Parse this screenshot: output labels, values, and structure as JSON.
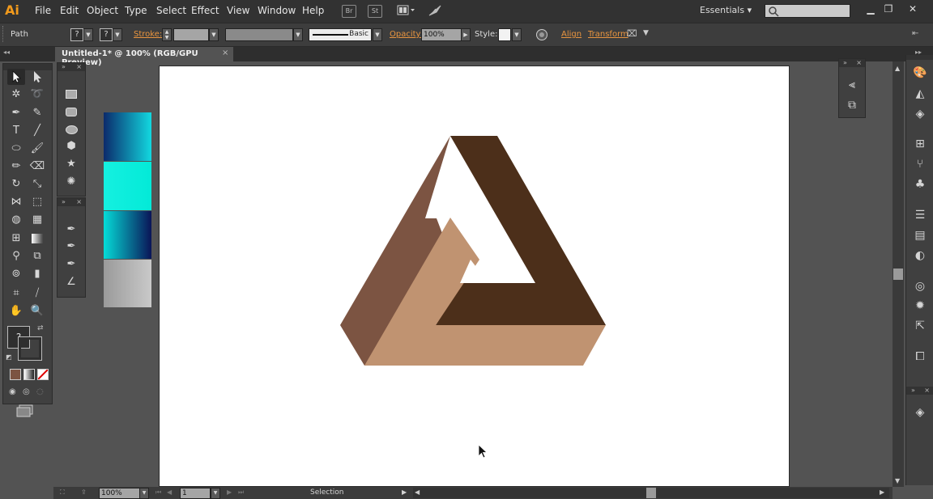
{
  "app": {
    "logo": "Ai"
  },
  "menu": [
    "File",
    "Edit",
    "Object",
    "Type",
    "Select",
    "Effect",
    "View",
    "Window",
    "Help"
  ],
  "menubar_icons": {
    "bridge": "Br",
    "stock": "St"
  },
  "workspace": "Essentials",
  "search": {
    "placeholder": ""
  },
  "control": {
    "selection_type": "Path",
    "fill_label": "?",
    "stroke_swatch_label": "?",
    "stroke_label": "Stroke:",
    "brush": "Basic",
    "opacity_label": "Opacity:",
    "opacity_value": "100%",
    "style_label": "Style:",
    "align_label": "Align",
    "transform_label": "Transform"
  },
  "document": {
    "tab_title": "Untitled-1* @ 100% (RGB/GPU Preview)"
  },
  "toolbox": {
    "fill_stroke_label": "?"
  },
  "gradient_swatches": [
    {
      "name": "navy-cyan",
      "from": "#0b2a6b",
      "to": "#12d8e0"
    },
    {
      "name": "cyan",
      "from": "#15f0e0",
      "to": "#03ead8"
    },
    {
      "name": "cyan-navy",
      "from": "#05dcd8",
      "to": "#0a1457"
    },
    {
      "name": "gray",
      "from": "#9a9a9a",
      "to": "#c9c9c9"
    }
  ],
  "artwork": {
    "name": "Penrose triangle",
    "colors": {
      "light": "#c09371",
      "medium": "#7c5442",
      "dark": "#4c2f1a"
    }
  },
  "status": {
    "zoom": "100%",
    "artboard": "1",
    "tool": "Selection"
  }
}
